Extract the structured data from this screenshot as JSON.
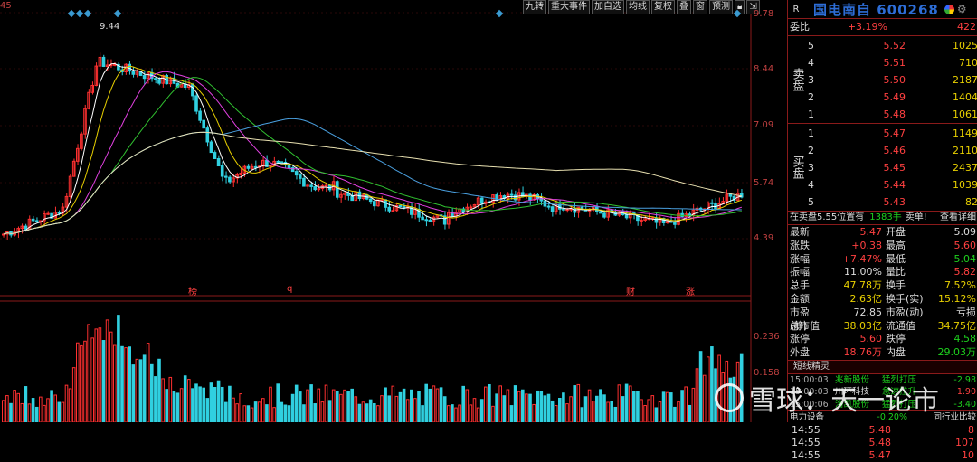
{
  "top_left_number": "45",
  "toolbar": [
    "九转",
    "重大事件",
    "加自选",
    "均线",
    "复权",
    "叠",
    "窗",
    "预测"
  ],
  "y_axis": [
    "9.78",
    "8.44",
    "7.09",
    "5.74",
    "4.39"
  ],
  "vol_axis": [
    "0.236",
    "0.158"
  ],
  "peak_label": "9.44",
  "event_markers": [
    {
      "text": "榜",
      "color": "#ff4040"
    },
    {
      "text": "q",
      "color": "#ff4040"
    },
    {
      "text": "财",
      "color": "#ff4040"
    },
    {
      "text": "涨",
      "color": "#ff4040"
    }
  ],
  "r_label": "R",
  "stock_title": "国电南自 600268",
  "weibi": {
    "label": "委比",
    "value": "+3.19%",
    "num": "422"
  },
  "sell_label": "卖盘",
  "buy_label": "买盘",
  "sell_orders": [
    {
      "lvl": "5",
      "price": "5.52",
      "vol": "1025"
    },
    {
      "lvl": "4",
      "price": "5.51",
      "vol": "710"
    },
    {
      "lvl": "3",
      "price": "5.50",
      "vol": "2187"
    },
    {
      "lvl": "2",
      "price": "5.49",
      "vol": "1404"
    },
    {
      "lvl": "1",
      "price": "5.48",
      "vol": "1061"
    }
  ],
  "buy_orders": [
    {
      "lvl": "1",
      "price": "5.47",
      "vol": "1149"
    },
    {
      "lvl": "2",
      "price": "5.46",
      "vol": "2110"
    },
    {
      "lvl": "3",
      "price": "5.45",
      "vol": "2437"
    },
    {
      "lvl": "4",
      "price": "5.44",
      "vol": "1039"
    },
    {
      "lvl": "5",
      "price": "5.43",
      "vol": "82"
    }
  ],
  "info_bar": {
    "left": "在卖盘5.55位置有",
    "mid": "1383手",
    "mid2": "卖单!",
    "right": "查看详细"
  },
  "quotes": [
    {
      "k": "最新",
      "v": "5.47",
      "vc": "red",
      "k2": "开盘",
      "v2": "5.09",
      "v2c": "white"
    },
    {
      "k": "涨跌",
      "v": "+0.38",
      "vc": "red",
      "k2": "最高",
      "v2": "5.60",
      "v2c": "red"
    },
    {
      "k": "涨幅",
      "v": "+7.47%",
      "vc": "red",
      "k2": "最低",
      "v2": "5.04",
      "v2c": "green"
    },
    {
      "k": "振幅",
      "v": "11.00%",
      "vc": "white",
      "k2": "量比",
      "v2": "5.82",
      "v2c": "red"
    },
    {
      "k": "总手",
      "v": "47.78万",
      "vc": "yellow",
      "k2": "换手",
      "v2": "7.52%",
      "v2c": "yellow"
    },
    {
      "k": "金额",
      "v": "2.63亿",
      "vc": "yellow",
      "k2": "换手(实)",
      "v2": "15.12%",
      "v2c": "yellow"
    },
    {
      "k": "市盈(静)",
      "v": "72.85",
      "vc": "white",
      "k2": "市盈(动)",
      "v2": "亏损",
      "v2c": "white"
    },
    {
      "k": "总市值",
      "v": "38.03亿",
      "vc": "yellow",
      "k2": "流通值",
      "v2": "34.75亿",
      "v2c": "yellow"
    },
    {
      "k": "涨停",
      "v": "5.60",
      "vc": "red",
      "k2": "跌停",
      "v2": "4.58",
      "v2c": "green"
    },
    {
      "k": "外盘",
      "v": "18.76万",
      "vc": "red",
      "k2": "内盘",
      "v2": "29.03万",
      "v2c": "green"
    }
  ],
  "signal_title": "短线精灵",
  "signals": [
    {
      "t": "15:00:03",
      "n": "兆新股份",
      "nc": "green",
      "a": "猛烈打压",
      "c": "-2.98",
      "cc": "green"
    },
    {
      "t": "15:00:03",
      "n": "川环科技",
      "nc": "white",
      "a": "急速拉升",
      "c": "1.90",
      "cc": "red"
    },
    {
      "t": "15:00:06",
      "n": "洛凯股份",
      "nc": "green",
      "a": "猛烈打压",
      "c": "-3.40",
      "cc": "green"
    }
  ],
  "sub_header": {
    "left": "电力设备",
    "mid": "-0.20%",
    "right": "同行业比较"
  },
  "ticks": [
    {
      "t": "14:55",
      "p": "5.48",
      "v": "8"
    },
    {
      "t": "14:55",
      "p": "5.48",
      "v": "107"
    },
    {
      "t": "14:55",
      "p": "5.47",
      "v": "10"
    }
  ],
  "watermark": "雪球：天一论市"
}
